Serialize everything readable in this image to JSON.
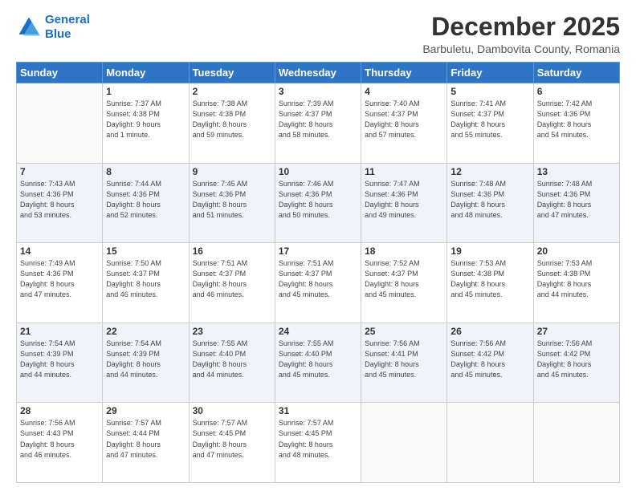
{
  "logo": {
    "line1": "General",
    "line2": "Blue"
  },
  "title": "December 2025",
  "subtitle": "Barbuletu, Dambovita County, Romania",
  "weekdays": [
    "Sunday",
    "Monday",
    "Tuesday",
    "Wednesday",
    "Thursday",
    "Friday",
    "Saturday"
  ],
  "weeks": [
    [
      {
        "day": "",
        "info": ""
      },
      {
        "day": "1",
        "info": "Sunrise: 7:37 AM\nSunset: 4:38 PM\nDaylight: 9 hours\nand 1 minute."
      },
      {
        "day": "2",
        "info": "Sunrise: 7:38 AM\nSunset: 4:38 PM\nDaylight: 8 hours\nand 59 minutes."
      },
      {
        "day": "3",
        "info": "Sunrise: 7:39 AM\nSunset: 4:37 PM\nDaylight: 8 hours\nand 58 minutes."
      },
      {
        "day": "4",
        "info": "Sunrise: 7:40 AM\nSunset: 4:37 PM\nDaylight: 8 hours\nand 57 minutes."
      },
      {
        "day": "5",
        "info": "Sunrise: 7:41 AM\nSunset: 4:37 PM\nDaylight: 8 hours\nand 55 minutes."
      },
      {
        "day": "6",
        "info": "Sunrise: 7:42 AM\nSunset: 4:36 PM\nDaylight: 8 hours\nand 54 minutes."
      }
    ],
    [
      {
        "day": "7",
        "info": "Sunrise: 7:43 AM\nSunset: 4:36 PM\nDaylight: 8 hours\nand 53 minutes."
      },
      {
        "day": "8",
        "info": "Sunrise: 7:44 AM\nSunset: 4:36 PM\nDaylight: 8 hours\nand 52 minutes."
      },
      {
        "day": "9",
        "info": "Sunrise: 7:45 AM\nSunset: 4:36 PM\nDaylight: 8 hours\nand 51 minutes."
      },
      {
        "day": "10",
        "info": "Sunrise: 7:46 AM\nSunset: 4:36 PM\nDaylight: 8 hours\nand 50 minutes."
      },
      {
        "day": "11",
        "info": "Sunrise: 7:47 AM\nSunset: 4:36 PM\nDaylight: 8 hours\nand 49 minutes."
      },
      {
        "day": "12",
        "info": "Sunrise: 7:48 AM\nSunset: 4:36 PM\nDaylight: 8 hours\nand 48 minutes."
      },
      {
        "day": "13",
        "info": "Sunrise: 7:48 AM\nSunset: 4:36 PM\nDaylight: 8 hours\nand 47 minutes."
      }
    ],
    [
      {
        "day": "14",
        "info": "Sunrise: 7:49 AM\nSunset: 4:36 PM\nDaylight: 8 hours\nand 47 minutes."
      },
      {
        "day": "15",
        "info": "Sunrise: 7:50 AM\nSunset: 4:37 PM\nDaylight: 8 hours\nand 46 minutes."
      },
      {
        "day": "16",
        "info": "Sunrise: 7:51 AM\nSunset: 4:37 PM\nDaylight: 8 hours\nand 46 minutes."
      },
      {
        "day": "17",
        "info": "Sunrise: 7:51 AM\nSunset: 4:37 PM\nDaylight: 8 hours\nand 45 minutes."
      },
      {
        "day": "18",
        "info": "Sunrise: 7:52 AM\nSunset: 4:37 PM\nDaylight: 8 hours\nand 45 minutes."
      },
      {
        "day": "19",
        "info": "Sunrise: 7:53 AM\nSunset: 4:38 PM\nDaylight: 8 hours\nand 45 minutes."
      },
      {
        "day": "20",
        "info": "Sunrise: 7:53 AM\nSunset: 4:38 PM\nDaylight: 8 hours\nand 44 minutes."
      }
    ],
    [
      {
        "day": "21",
        "info": "Sunrise: 7:54 AM\nSunset: 4:39 PM\nDaylight: 8 hours\nand 44 minutes."
      },
      {
        "day": "22",
        "info": "Sunrise: 7:54 AM\nSunset: 4:39 PM\nDaylight: 8 hours\nand 44 minutes."
      },
      {
        "day": "23",
        "info": "Sunrise: 7:55 AM\nSunset: 4:40 PM\nDaylight: 8 hours\nand 44 minutes."
      },
      {
        "day": "24",
        "info": "Sunrise: 7:55 AM\nSunset: 4:40 PM\nDaylight: 8 hours\nand 45 minutes."
      },
      {
        "day": "25",
        "info": "Sunrise: 7:56 AM\nSunset: 4:41 PM\nDaylight: 8 hours\nand 45 minutes."
      },
      {
        "day": "26",
        "info": "Sunrise: 7:56 AM\nSunset: 4:42 PM\nDaylight: 8 hours\nand 45 minutes."
      },
      {
        "day": "27",
        "info": "Sunrise: 7:56 AM\nSunset: 4:42 PM\nDaylight: 8 hours\nand 45 minutes."
      }
    ],
    [
      {
        "day": "28",
        "info": "Sunrise: 7:56 AM\nSunset: 4:43 PM\nDaylight: 8 hours\nand 46 minutes."
      },
      {
        "day": "29",
        "info": "Sunrise: 7:57 AM\nSunset: 4:44 PM\nDaylight: 8 hours\nand 47 minutes."
      },
      {
        "day": "30",
        "info": "Sunrise: 7:57 AM\nSunset: 4:45 PM\nDaylight: 8 hours\nand 47 minutes."
      },
      {
        "day": "31",
        "info": "Sunrise: 7:57 AM\nSunset: 4:45 PM\nDaylight: 8 hours\nand 48 minutes."
      },
      {
        "day": "",
        "info": ""
      },
      {
        "day": "",
        "info": ""
      },
      {
        "day": "",
        "info": ""
      }
    ]
  ]
}
